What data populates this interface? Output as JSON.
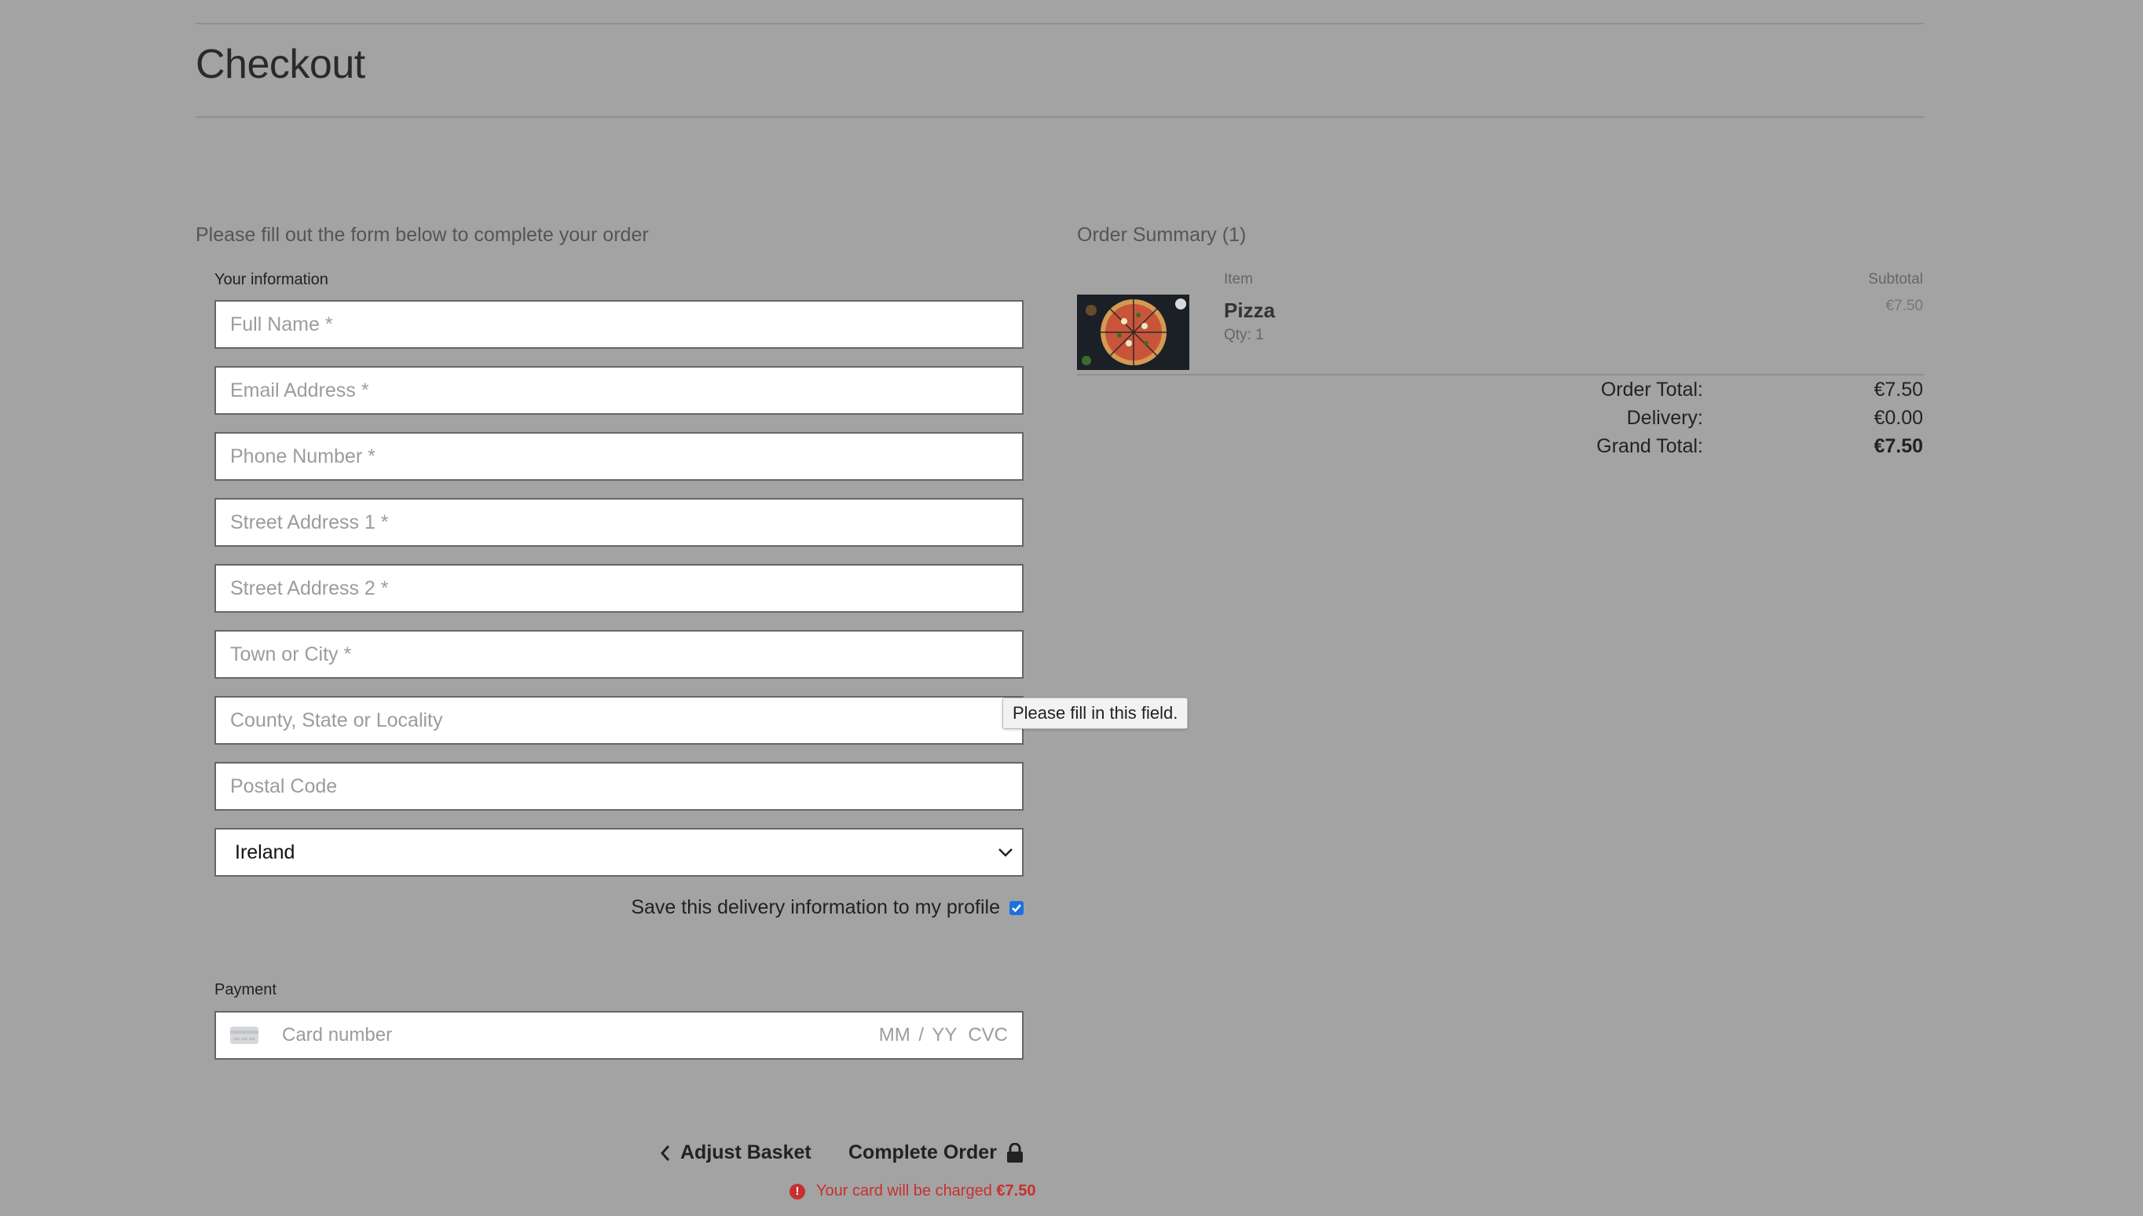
{
  "page": {
    "title": "Checkout",
    "form_intro": "Please fill out the form below to complete your order"
  },
  "info_section": {
    "label": "Your information",
    "fields": {
      "full_name": "Full Name *",
      "email": "Email Address *",
      "phone": "Phone Number *",
      "street1": "Street Address 1 *",
      "street2": "Street Address 2 *",
      "town": "Town or City *",
      "county": "County, State or Locality",
      "postcode": "Postal Code"
    },
    "country_selected": "Ireland",
    "save_profile_label": "Save this delivery information to my profile",
    "save_profile_checked": true
  },
  "validation_tooltip": "Please fill in this field.",
  "payment": {
    "label": "Payment",
    "card_number_placeholder": "Card number",
    "expiry_placeholder": "MM / YY",
    "cvc_placeholder": "CVC"
  },
  "summary": {
    "title": "Order Summary (1)",
    "col_item": "Item",
    "col_subtotal": "Subtotal",
    "items": [
      {
        "name": "Pizza",
        "qty": "Qty: 1",
        "subtotal": "€7.50",
        "image_icon": "pizza-image"
      }
    ],
    "order_total_label": "Order Total:",
    "order_total": "€7.50",
    "delivery_label": "Delivery:",
    "delivery": "€0.00",
    "grand_total_label": "Grand Total:",
    "grand_total": "€7.50"
  },
  "actions": {
    "adjust_basket": "Adjust Basket",
    "complete_order": "Complete Order",
    "charge_note_prefix": "Your card will be charged",
    "charge_amount": "€7.50"
  },
  "colors": {
    "background": "#a3a3a3",
    "error": "#c8302f",
    "checkbox": "#1e6fe0"
  }
}
